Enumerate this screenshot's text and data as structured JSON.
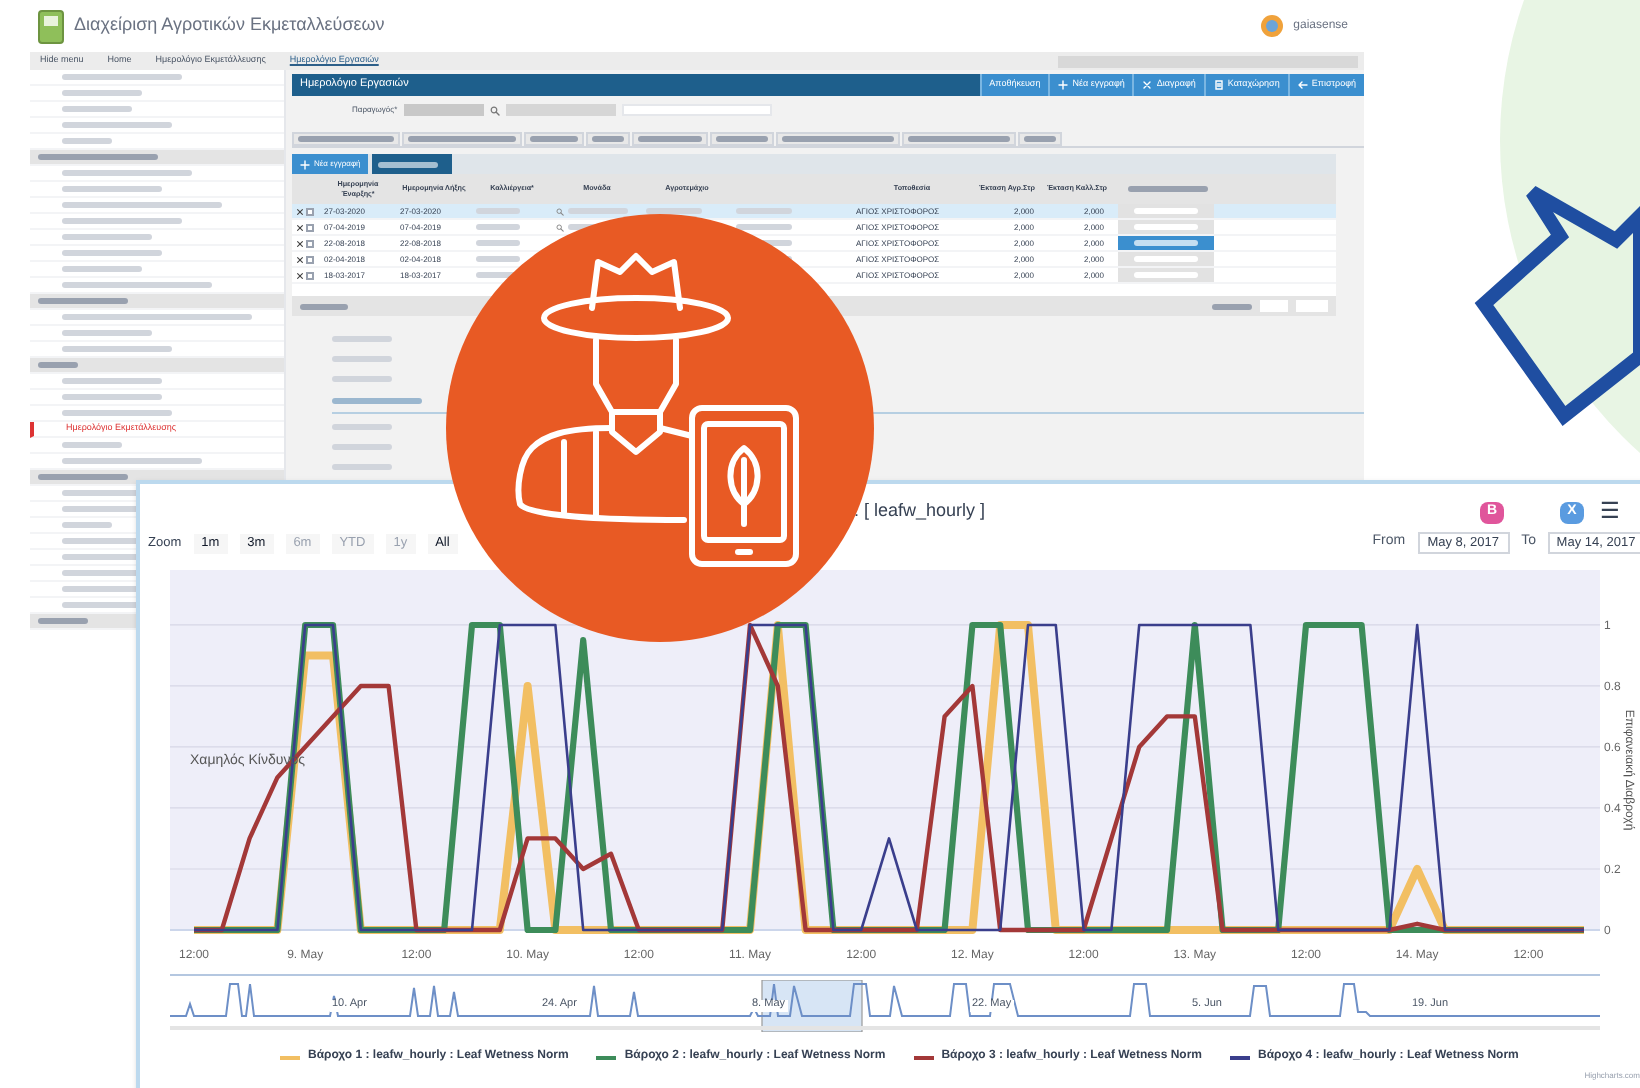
{
  "app": {
    "title": "Διαχείριση Αγροτικών Εκμεταλλεύσεων",
    "logo_text": "gaiasense",
    "menubar": [
      {
        "label": "Hide menu",
        "selected": false
      },
      {
        "label": "Home",
        "selected": false
      },
      {
        "label": "Ημερολόγιο Εκμετάλλευσης",
        "selected": false
      },
      {
        "label": "Ημερολόγιο Εργασιών",
        "selected": true
      }
    ],
    "sidebar_selected": "Ημερολόγιο Εκμετάλλευσης",
    "panel_title": "Ημερολόγιο Εργασιών",
    "actions": [
      {
        "label": "Αποθήκευση",
        "kind": "plain"
      },
      {
        "label": "Νέα εγγραφή",
        "kind": "add"
      },
      {
        "label": "Διαγραφή",
        "kind": "delete"
      },
      {
        "label": "Καταχώρηση",
        "kind": "register"
      },
      {
        "label": "Επιστροφή",
        "kind": "back"
      }
    ],
    "producer_label": "Παραγωγός*",
    "table_buttons": [
      {
        "label": "Νέα εγγραφή",
        "kind": "add"
      }
    ],
    "columns": [
      "Ημερομηνία Έναρξης*",
      "Ημερομηνία Λήξης",
      "Καλλιέργεια*",
      "Μονάδα",
      "Αγροτεμάχιο",
      "",
      "Τοποθεσία",
      "Έκταση Αγρ.Στρ",
      "Έκταση Καλλ.Στρ"
    ],
    "rows": [
      {
        "start": "27-03-2020",
        "end": "27-03-2020",
        "location": "ΑΓΙΟΣ ΧΡΙΣΤΟΦΟΡΟΣ",
        "area1": "2,000",
        "area2": "2,000",
        "selected": true
      },
      {
        "start": "07-04-2019",
        "end": "07-04-2019",
        "location": "ΑΓΙΟΣ ΧΡΙΣΤΟΦΟΡΟΣ",
        "area1": "2,000",
        "area2": "2,000",
        "selected": false
      },
      {
        "start": "22-08-2018",
        "end": "22-08-2018",
        "location": "ΑΓΙΟΣ ΧΡΙΣΤΟΦΟΡΟΣ",
        "area1": "2,000",
        "area2": "2,000",
        "selected": false
      },
      {
        "start": "02-04-2018",
        "end": "02-04-2018",
        "location": "ΑΓΙΟΣ ΧΡΙΣΤΟΦΟΡΟΣ",
        "area1": "2,000",
        "area2": "2,000",
        "selected": false
      },
      {
        "start": "18-03-2017",
        "end": "18-03-2017",
        "location": "ΑΓΙΟΣ ΧΡΙΣΤΟΦΟΡΟΣ",
        "area1": "2,000",
        "area2": "2,000",
        "selected": false
      }
    ]
  },
  "chart_window": {
    "title": ": [ leafw_hourly ]",
    "zoom_label": "Zoom",
    "zoom_buttons": [
      {
        "label": "1m",
        "disabled": false
      },
      {
        "label": "3m",
        "disabled": false
      },
      {
        "label": "6m",
        "disabled": true
      },
      {
        "label": "YTD",
        "disabled": true
      },
      {
        "label": "1y",
        "disabled": true
      },
      {
        "label": "All",
        "disabled": false
      }
    ],
    "from_label": "From",
    "from": "May 8, 2017",
    "to_label": "To",
    "to": "May 14, 2017",
    "badges": [
      {
        "label": "B",
        "color": "#e0559b"
      },
      {
        "label": "X",
        "color": "#5a9be0"
      }
    ],
    "menu_glyph": "☰",
    "band_label": "Χαμηλός Κίνδυνος",
    "chart_data": {
      "type": "line",
      "ylabel": "Επιφανειακή Διαβροχή",
      "ylim": [
        0,
        1.18
      ],
      "grid": true,
      "yticks": [
        0,
        0.2,
        0.4,
        0.6,
        0.8,
        1
      ],
      "categories": [
        "12:00",
        null,
        null,
        null,
        "9. May",
        null,
        null,
        null,
        "12:00",
        null,
        null,
        null,
        "10. May",
        null,
        null,
        null,
        "12:00",
        null,
        null,
        null,
        "11. May",
        null,
        null,
        null,
        "12:00",
        null,
        null,
        null,
        "12. May",
        null,
        null,
        null,
        "12:00",
        null,
        null,
        null,
        "13. May",
        null,
        null,
        null,
        "12:00",
        null,
        null,
        null,
        "14. May",
        null,
        null,
        null,
        "12:00",
        null,
        null
      ],
      "series": [
        {
          "name": "Βάροχο 1 : leafw_hourly : Leaf Wetness Norm",
          "color": "#f2bf63",
          "values": [
            0,
            0,
            0,
            0,
            0.9,
            0.9,
            0,
            0,
            0,
            0,
            0,
            0,
            0.8,
            0,
            0,
            0,
            0,
            0,
            0,
            0,
            0,
            1,
            0,
            0,
            0,
            0,
            0,
            0,
            0,
            1,
            1,
            0,
            0,
            0,
            0,
            0,
            0,
            0,
            0,
            0,
            0,
            0,
            0,
            0,
            0.2,
            0,
            0,
            0,
            0,
            0,
            0
          ]
        },
        {
          "name": "Βάροχο 2 : leafw_hourly : Leaf Wetness Norm",
          "color": "#3d8c5a",
          "values": [
            0,
            0,
            0,
            0,
            1,
            1,
            0,
            0,
            0,
            0,
            1,
            1,
            0,
            0,
            0.95,
            0,
            0,
            0,
            0,
            0,
            0,
            1,
            1,
            0,
            0,
            0,
            0,
            0,
            1,
            1,
            0,
            0,
            0,
            0,
            0,
            0,
            1,
            0,
            0,
            0,
            1,
            1,
            1,
            0,
            0,
            0,
            0,
            0,
            0,
            0,
            0
          ]
        },
        {
          "name": "Βάροχο 3 : leafw_hourly : Leaf Wetness Norm",
          "color": "#a33838",
          "values": [
            0,
            0,
            0.3,
            0.5,
            0.6,
            0.7,
            0.8,
            0.8,
            0,
            0,
            0,
            0,
            0.3,
            0.3,
            0.2,
            0.25,
            0,
            0,
            0,
            0,
            1,
            0.8,
            0,
            0,
            0,
            0,
            0,
            0.7,
            0.8,
            0,
            0,
            0,
            0,
            0.3,
            0.6,
            0.7,
            0.7,
            0,
            0,
            0,
            0,
            0,
            0,
            0,
            0.02,
            0,
            0,
            0,
            0,
            0,
            0
          ]
        },
        {
          "name": "Βάροχο 4 : leafw_hourly : Leaf Wetness Norm",
          "color": "#3a3e8c",
          "values": [
            0,
            0,
            0,
            0,
            1,
            1,
            0,
            0,
            0,
            0,
            0,
            1,
            1,
            1,
            0,
            0,
            0,
            0,
            0,
            0,
            1,
            1,
            1,
            0,
            0,
            0.3,
            0,
            0,
            0,
            0,
            1,
            1,
            0,
            0,
            1,
            1,
            1,
            1,
            1,
            0,
            0,
            0,
            0,
            0,
            1,
            0,
            0,
            0,
            0,
            0,
            0
          ]
        }
      ]
    },
    "navigator_labels": [
      "10. Apr",
      "24. Apr",
      "8. May",
      "22. May",
      "5. Jun",
      "19. Jun"
    ],
    "credit": "Highcharts.com"
  }
}
